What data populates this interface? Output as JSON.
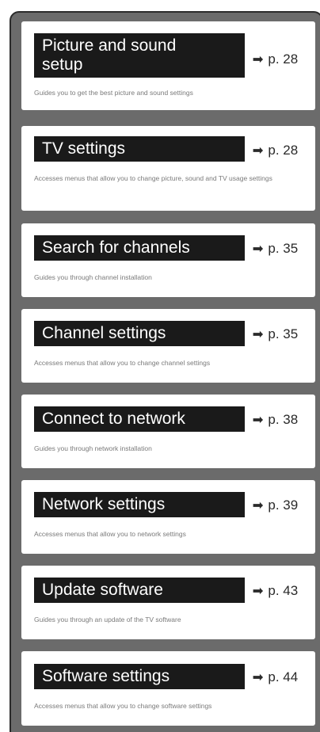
{
  "items": [
    {
      "title_line1": "Picture and sound",
      "title_line2": "setup",
      "page_ref": "p. 28",
      "description": "Guides you to get the best picture and sound settings"
    },
    {
      "title_line1": "TV settings",
      "page_ref": "p. 28",
      "description": "Accesses menus that allow you to change picture, sound and TV usage settings"
    },
    {
      "title_line1": "Search for channels",
      "page_ref": "p. 35",
      "description": "Guides you through channel installation"
    },
    {
      "title_line1": "Channel settings",
      "page_ref": "p. 35",
      "description": "Accesses menus that allow you to change channel settings"
    },
    {
      "title_line1": "Connect to network",
      "page_ref": "p. 38",
      "description": "Guides you through network installation"
    },
    {
      "title_line1": "Network settings",
      "page_ref": "p. 39",
      "description": "Accesses menus that allow you to network settings"
    },
    {
      "title_line1": "Update software",
      "page_ref": "p. 43",
      "description": "Guides you through an update of the TV software"
    },
    {
      "title_line1": "Software settings",
      "page_ref": "p. 44",
      "description": "Accesses menus that allow you to change software settings"
    }
  ],
  "arrow_glyph": "➟"
}
